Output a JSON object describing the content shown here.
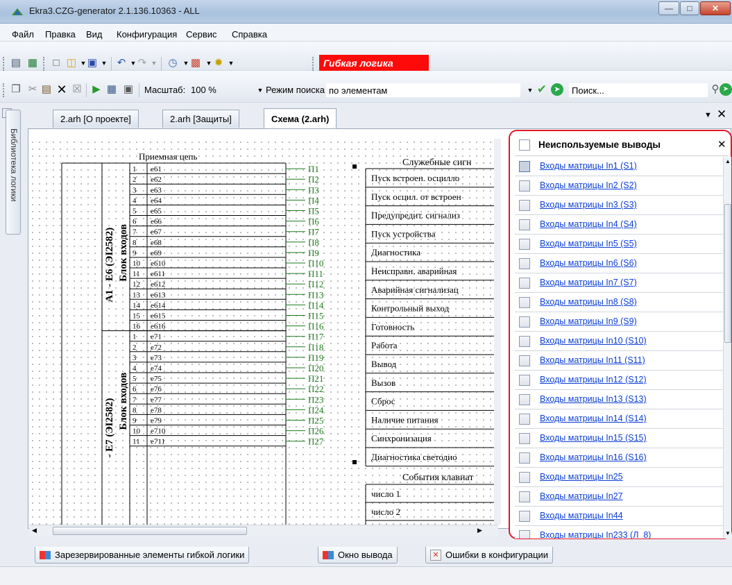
{
  "window": {
    "title": "Ekra3.CZG-generator 2.1.136.10363 - ALL"
  },
  "menu": [
    "Файл",
    "Правка",
    "Вид",
    "Конфигурация",
    "Сервис",
    "Справка"
  ],
  "toolbar": {
    "flex_logic_label": "Гибкая логика",
    "scale_label": "Масштаб:",
    "scale_value": "100 %",
    "search_mode_label": "Режим поиска",
    "search_mode_value": "по элементам",
    "search_placeholder": "Поиск..."
  },
  "side_tab": {
    "label": "Библиотека логики"
  },
  "doc_tabs": [
    "2.arh [О проекте]",
    "2.arh [Защиты]",
    "Схема (2.arh)"
  ],
  "diagram": {
    "header_left": "Приемная цепь",
    "block1_label_a": "А1 - Е6 (ЭI2582)",
    "block1_label_b": "Блок входов",
    "block2_label_a": "- Е7 (ЭI2582)",
    "block2_label_b": "Блок входов",
    "block1_rows": [
      {
        "n": "1",
        "e": "e61",
        "p": "П1"
      },
      {
        "n": "2",
        "e": "e62",
        "p": "П2"
      },
      {
        "n": "3",
        "e": "e63",
        "p": "П3"
      },
      {
        "n": "4",
        "e": "e64",
        "p": "П4"
      },
      {
        "n": "5",
        "e": "e65",
        "p": "П5"
      },
      {
        "n": "6",
        "e": "e66",
        "p": "П6"
      },
      {
        "n": "7",
        "e": "e67",
        "p": "П7"
      },
      {
        "n": "8",
        "e": "e68",
        "p": "П8"
      },
      {
        "n": "9",
        "e": "e69",
        "p": "П9"
      },
      {
        "n": "10",
        "e": "e610",
        "p": "П10"
      },
      {
        "n": "11",
        "e": "e611",
        "p": "П11"
      },
      {
        "n": "12",
        "e": "e612",
        "p": "П12"
      },
      {
        "n": "13",
        "e": "e613",
        "p": "П13"
      },
      {
        "n": "14",
        "e": "e614",
        "p": "П14"
      },
      {
        "n": "15",
        "e": "e615",
        "p": "П15"
      },
      {
        "n": "16",
        "e": "e616",
        "p": "П16"
      }
    ],
    "block2_rows": [
      {
        "n": "1",
        "e": "e71",
        "p": "П17"
      },
      {
        "n": "2",
        "e": "e72",
        "p": "П18"
      },
      {
        "n": "3",
        "e": "e73",
        "p": "П19"
      },
      {
        "n": "4",
        "e": "e74",
        "p": "П20"
      },
      {
        "n": "5",
        "e": "e75",
        "p": "П21"
      },
      {
        "n": "6",
        "e": "e76",
        "p": "П22"
      },
      {
        "n": "7",
        "e": "e77",
        "p": "П23"
      },
      {
        "n": "8",
        "e": "e78",
        "p": "П24"
      },
      {
        "n": "9",
        "e": "e79",
        "p": "П25"
      },
      {
        "n": "10",
        "e": "e710",
        "p": "П26"
      },
      {
        "n": "11",
        "e": "e711",
        "p": "П27"
      }
    ],
    "service_header": "Служебные сигн",
    "service_rows": [
      "Пуск встроен. осцилло",
      "Пуск осцил. от встроен",
      "Предупредит. сигнализ",
      "Пуск устройства",
      "Диагностика",
      "Неисправн. аварийная",
      "Аварийная сигнализац",
      "Контрольный выход",
      "Готовность",
      "Работа",
      "Вывод",
      "Вызов",
      "Сброс",
      "Наличие питания",
      "Синхронизация",
      "Диагностика светодио"
    ],
    "events_header": "События клавиат",
    "events_rows": [
      "число 1",
      "число 2"
    ]
  },
  "unused_panel": {
    "title": "Неиспользуемые выводы",
    "items": [
      "Входы матрицы In1 (S1)",
      "Входы матрицы In2 (S2)",
      "Входы матрицы In3 (S3)",
      "Входы матрицы In4 (S4)",
      "Входы матрицы In5 (S5)",
      "Входы матрицы In6 (S6)",
      "Входы матрицы In7 (S7)",
      "Входы матрицы In8 (S8)",
      "Входы матрицы In9 (S9)",
      "Входы матрицы In10 (S10)",
      "Входы матрицы In11 (S11)",
      "Входы матрицы In12 (S12)",
      "Входы матрицы In13 (S13)",
      "Входы матрицы In14 (S14)",
      "Входы матрицы In15 (S15)",
      "Входы матрицы In16 (S16)",
      "Входы матрицы In25",
      "Входы матрицы In27",
      "Входы матрицы In44",
      "Входы матрицы In233 (Л_8)"
    ]
  },
  "bottom_tabs": [
    "Зарезервированные элементы гибкой логики",
    "Окно вывода",
    "Ошибки в конфигурации"
  ],
  "colors": {
    "accent_red": "#ff0a0a",
    "highlight_border": "#e0182b",
    "link": "#0b3ed6",
    "pin_green": "#1a7a1a"
  }
}
